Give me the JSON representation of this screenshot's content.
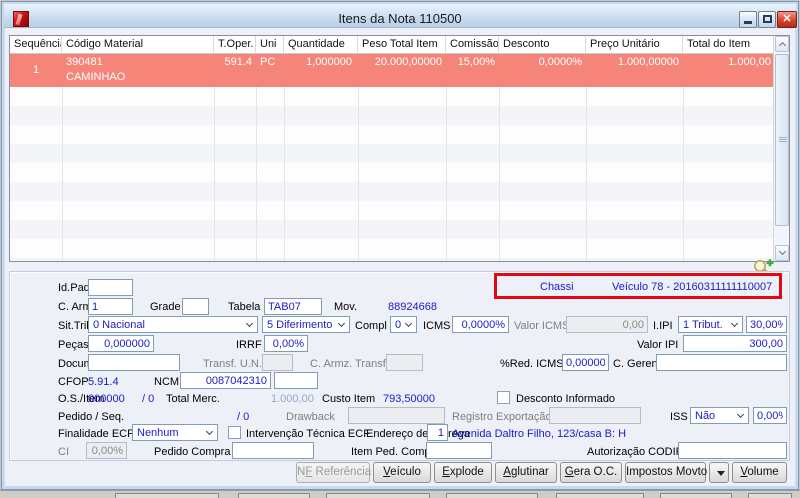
{
  "window": {
    "title": "Itens da Nota 110500",
    "controls": {
      "minimize": "minimize",
      "maximize": "maximize",
      "close": "✕"
    }
  },
  "table": {
    "columns": [
      "Sequência",
      "Código Material",
      "T.Oper.",
      "Uni",
      "Quantidade",
      "Peso Total Item",
      "Comissão",
      "Desconto",
      "Preço Unitário",
      "Total do Item"
    ],
    "row": {
      "sequencia": "1",
      "codigo": "390481",
      "codigo_desc": "CAMINHAO",
      "toper": "591.4",
      "uni": "PC",
      "quantidade": "1,000000",
      "peso": "20.000,00000",
      "comissao": "15,00%",
      "desconto": "0,0000%",
      "preco": "1.000,00000",
      "total": "1.000,00"
    }
  },
  "annotation": {
    "chassi_label": "Chassi",
    "veiculo_value": "Veículo 78 - 20160311111110007",
    "box_color": "#e30613"
  },
  "form": {
    "id_padrao": {
      "label": "Id.Padrão:",
      "value": ""
    },
    "c_arm": {
      "label": "C. Arm.",
      "value": "1"
    },
    "grade": {
      "label": "Grade",
      "value": ""
    },
    "tabela": {
      "label": "Tabela",
      "value": "TAB07"
    },
    "mov": {
      "label": "Mov.",
      "value": "88924668"
    },
    "sit_trib": {
      "label": "Sit.Trib.",
      "value": "0 Nacional",
      "value2": "5 Diferimento"
    },
    "compl": {
      "label": "Compl",
      "value": "0"
    },
    "icms": {
      "label": "ICMS",
      "value": "0,0000%"
    },
    "valor_icms": {
      "label": "Valor ICMS",
      "value": "0,00"
    },
    "iipi": {
      "label": "I.IPI",
      "value": "1 Tribut.",
      "pct": "30,00%"
    },
    "pecas": {
      "label": "Peças",
      "value": "0,000000"
    },
    "irrf": {
      "label": "IRRF",
      "value": "0,00%"
    },
    "valor_ipi": {
      "label": "Valor IPI",
      "value": "300,00"
    },
    "documento": {
      "label": "Documento",
      "value": ""
    },
    "transf_un": {
      "label": "Transf. U.N.",
      "value": ""
    },
    "c_armz_transf": {
      "label": "C. Armz. Transf.",
      "value": ""
    },
    "red_icms": {
      "label": "%Red. ICMS",
      "value": "0,00000%"
    },
    "c_gerencial": {
      "label": "C. Gerencial",
      "value": ""
    },
    "cfop": {
      "label": "CFOP",
      "value": "5.91.4"
    },
    "ncm": {
      "label": "NCM",
      "value": "0087042310",
      "extra": ""
    },
    "os_item": {
      "label": "O.S./Item",
      "value": "000000",
      "seq": "/ 0"
    },
    "total_merc": {
      "label": "Total Merc.",
      "value": "1.000,00"
    },
    "custo_item": {
      "label": "Custo Item",
      "value": "793,50000"
    },
    "desconto_informado": {
      "label": "Desconto Informado",
      "checked": false
    },
    "pedido_seq": {
      "label": "Pedido / Seq.",
      "value": "/ 0"
    },
    "drawback": {
      "label": "Drawback",
      "value": ""
    },
    "registro_exportacao": {
      "label": "Registro Exportação",
      "value": ""
    },
    "iss": {
      "label": "ISS",
      "value": "Não",
      "pct": "0,00%"
    },
    "finalidade_ecf": {
      "label": "Finalidade ECF",
      "value": "Nenhum"
    },
    "intervencao_ecf": {
      "label": "Intervenção Técnica ECF",
      "checked": false
    },
    "endereco_entrega": {
      "label": "Endereço de Entrega",
      "value": "1",
      "address": "Avenida Daltro Filho, 123/casa B: H"
    },
    "ci": {
      "label": "CI",
      "value": "0,00%"
    },
    "pedido_compra": {
      "label": "Pedido Compra",
      "value": ""
    },
    "item_ped_compra": {
      "label": "Item Ped. Compra",
      "value": ""
    },
    "autorizacao_codif": {
      "label": "Autorização CODIF",
      "value": ""
    }
  },
  "buttons": [
    {
      "pre": "N",
      "mn": "F",
      "rest": " Referência",
      "disabled": true
    },
    {
      "pre": "",
      "mn": "V",
      "rest": "eículo",
      "disabled": false
    },
    {
      "pre": "",
      "mn": "E",
      "rest": "xplode",
      "disabled": false
    },
    {
      "pre": "",
      "mn": "A",
      "rest": "glutinar",
      "disabled": false
    },
    {
      "pre": "",
      "mn": "G",
      "rest": "era O.C.",
      "disabled": false
    },
    {
      "pre": "Impostos Movto",
      "mn": "",
      "rest": "",
      "disabled": false
    },
    {
      "pre": "",
      "mn": "V",
      "rest": "olume",
      "disabled": false
    }
  ],
  "icons": {
    "app": "red-gem-logo",
    "zoom": "magnifier-plus",
    "dropdown": "chevron-down"
  },
  "colors": {
    "value_blue": "#1a1acd",
    "selected_row": "#f58579",
    "annotation_red": "#e30613"
  }
}
